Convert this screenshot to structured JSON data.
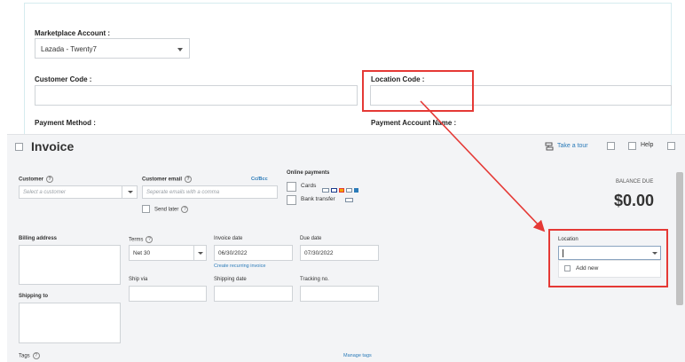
{
  "top_form": {
    "marketplace_account_label": "Marketplace Account :",
    "marketplace_account_value": "Lazada - Twenty7",
    "customer_code_label": "Customer Code :",
    "location_code_label": "Location Code :",
    "payment_method_label": "Payment Method :",
    "payment_account_name_label": "Payment Account Name :"
  },
  "invoice": {
    "title": "Invoice",
    "take_tour": "Take a tour",
    "help": "Help",
    "customer_label": "Customer",
    "customer_placeholder": "Select a customer",
    "customer_email_label": "Customer email",
    "cc_bcc": "Cc/Bcc",
    "email_placeholder": "Seperate emails with a comma",
    "send_later": "Send later",
    "online_payments_label": "Online payments",
    "cards_label": "Cards",
    "bank_transfer_label": "Bank transfer",
    "balance_due_label": "BALANCE DUE",
    "balance_due_value": "$0.00",
    "billing_address_label": "Billing address",
    "terms_label": "Terms",
    "terms_value": "Net 30",
    "invoice_date_label": "Invoice date",
    "invoice_date_value": "06/30/2022",
    "create_recurring": "Create recurring invoice",
    "due_date_label": "Due date",
    "due_date_value": "07/30/2022",
    "ship_via_label": "Ship via",
    "shipping_date_label": "Shipping date",
    "tracking_no_label": "Tracking no.",
    "shipping_to_label": "Shipping to",
    "location_label": "Location",
    "add_new": "Add new",
    "tags_label": "Tags",
    "manage_tags": "Manage tags"
  },
  "colors": {
    "highlight": "#e53935",
    "link": "#2b7bb9",
    "invoice_bg": "#f3f4f6"
  }
}
